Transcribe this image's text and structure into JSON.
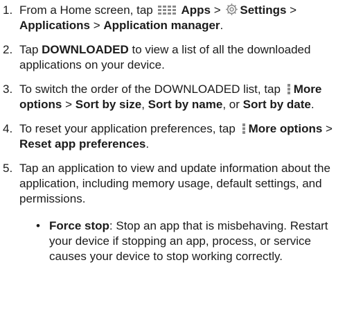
{
  "colors": {
    "text": "#1b1b1b",
    "icon": "#8a8a8a"
  },
  "steps": [
    {
      "num": "1.",
      "t1": "From a Home screen, tap",
      "b1": "Apps",
      "t2": " > ",
      "b2": "Settings",
      "t3": " > ",
      "b3": "Applications",
      "t4": " > ",
      "b4": "Application manager",
      "t5": "."
    },
    {
      "num": "2.",
      "t1": "Tap ",
      "b1": "DOWNLOADED",
      "t2": " to view a list of all the downloaded applications on your device."
    },
    {
      "num": "3.",
      "t1": "To switch the order of the DOWNLOADED list, tap",
      "b1": "More options",
      "t2": " > ",
      "b2": "Sort by size",
      "t3": ", ",
      "b3": "Sort by name",
      "t4": ", or ",
      "b4": "Sort by date",
      "t5": "."
    },
    {
      "num": "4.",
      "t1": "To reset your application preferences, tap",
      "b1": "More options",
      "t2": " > ",
      "b2": "Reset app preferences",
      "t3": "."
    },
    {
      "num": "5.",
      "t1": "Tap an application to view and update information about the application, including memory usage, default settings, and permissions."
    }
  ],
  "bullets": [
    {
      "dot": "•",
      "b1": "Force stop",
      "t1": ": Stop an app that is misbehaving. Restart your device if stopping an app, process, or service causes your device to stop working correctly."
    }
  ],
  "icons": {
    "apps": "apps-grid-icon",
    "settings": "settings-gear-icon",
    "more_options": "more-options-icon"
  }
}
